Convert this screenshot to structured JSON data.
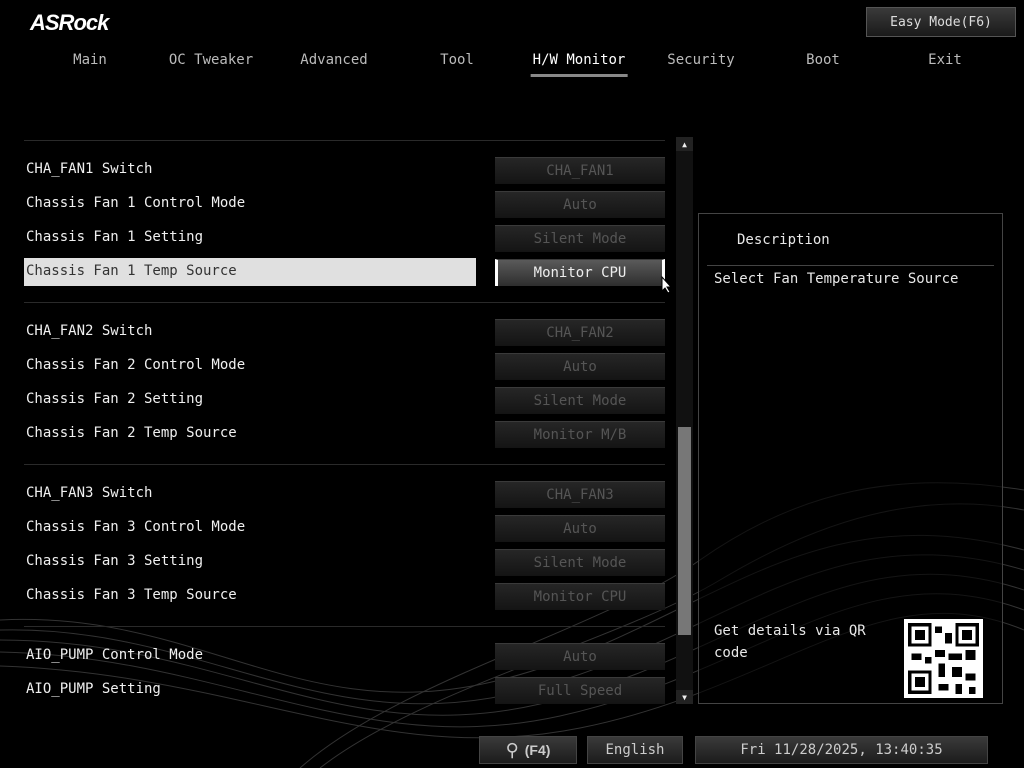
{
  "header": {
    "logo": "ASRock",
    "easy_mode": "Easy Mode(F6)"
  },
  "tabs": [
    {
      "label": "Main"
    },
    {
      "label": "OC Tweaker"
    },
    {
      "label": "Advanced"
    },
    {
      "label": "Tool"
    },
    {
      "label": "H/W Monitor"
    },
    {
      "label": "Security"
    },
    {
      "label": "Boot"
    },
    {
      "label": "Exit"
    }
  ],
  "rows": [
    {
      "label": "CHA_FAN1 Switch",
      "value": "CHA_FAN1"
    },
    {
      "label": "Chassis Fan 1 Control Mode",
      "value": "Auto"
    },
    {
      "label": "Chassis Fan 1 Setting",
      "value": "Silent Mode"
    },
    {
      "label": "Chassis Fan 1 Temp Source",
      "value": "Monitor CPU"
    },
    {
      "label": "CHA_FAN2 Switch",
      "value": "CHA_FAN2"
    },
    {
      "label": "Chassis Fan 2 Control Mode",
      "value": "Auto"
    },
    {
      "label": "Chassis Fan 2 Setting",
      "value": "Silent Mode"
    },
    {
      "label": "Chassis Fan 2 Temp Source",
      "value": "Monitor M/B"
    },
    {
      "label": "CHA_FAN3 Switch",
      "value": "CHA_FAN3"
    },
    {
      "label": "Chassis Fan 3 Control Mode",
      "value": "Auto"
    },
    {
      "label": "Chassis Fan 3 Setting",
      "value": "Silent Mode"
    },
    {
      "label": "Chassis Fan 3 Temp Source",
      "value": "Monitor CPU"
    },
    {
      "label": "AIO_PUMP Control Mode",
      "value": "Auto"
    },
    {
      "label": "AIO_PUMP Setting",
      "value": "Full Speed"
    }
  ],
  "description": {
    "title": "Description",
    "text": "Select Fan Temperature Source",
    "qr_text": "Get details via QR code"
  },
  "footer": {
    "search": "(F4)",
    "language": "English",
    "datetime": "Fri 11/28/2025, 13:40:35"
  }
}
